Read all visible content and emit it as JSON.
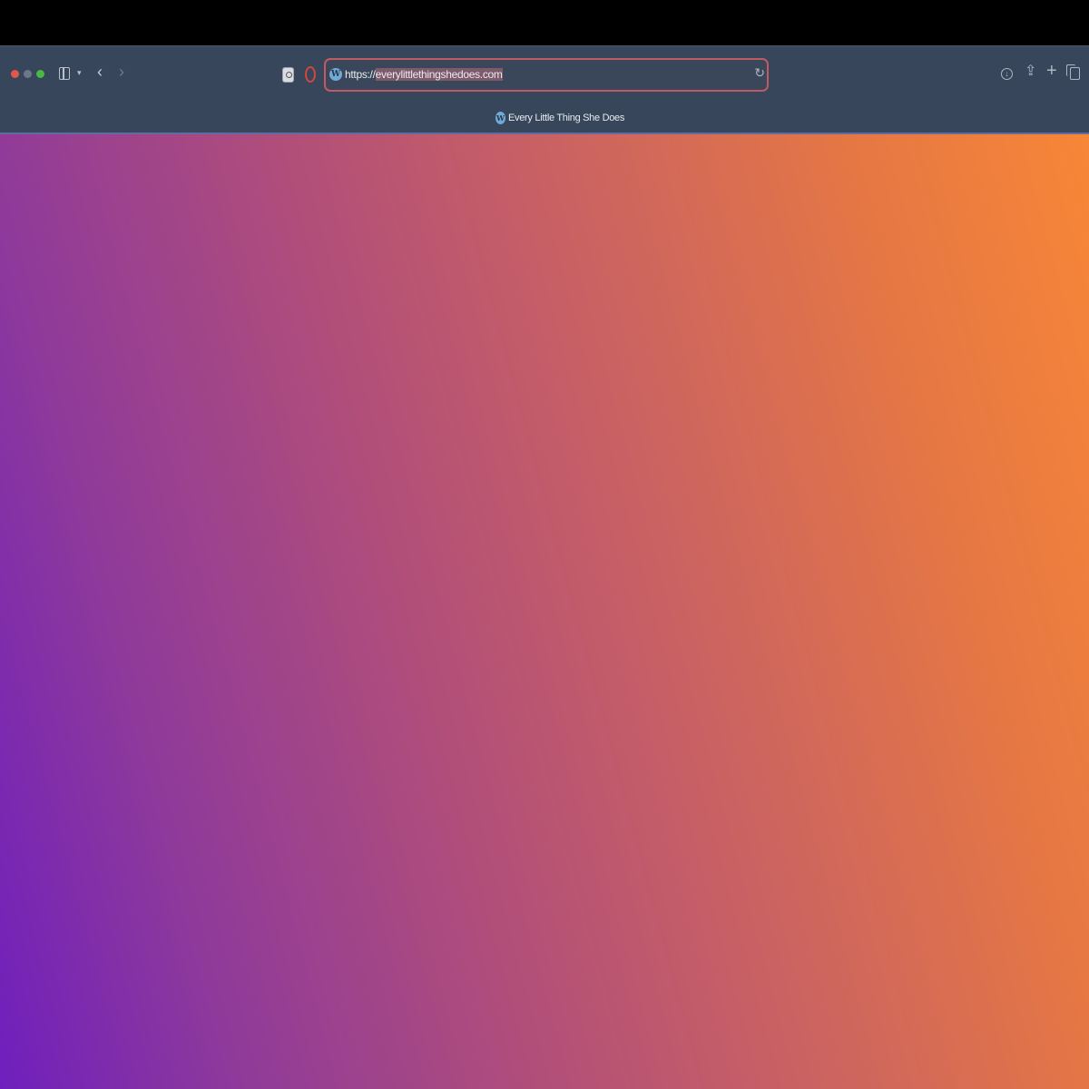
{
  "browser": {
    "url": {
      "prefix": "https://",
      "selected": "everylittlethingshedoes.com"
    },
    "tab": {
      "title": "Every Little Thing She Does"
    },
    "icons": {
      "wp_logo": "W",
      "caret": "▾",
      "back": "‹",
      "forward": "›",
      "reload": "↻",
      "download": "↓",
      "share": "⇪",
      "new_tab": "+"
    }
  },
  "colors": {
    "toolbar": "#37465a",
    "url_border": "#c25a64",
    "gradient_start": "#6f1fbd",
    "gradient_end": "#f88637"
  }
}
